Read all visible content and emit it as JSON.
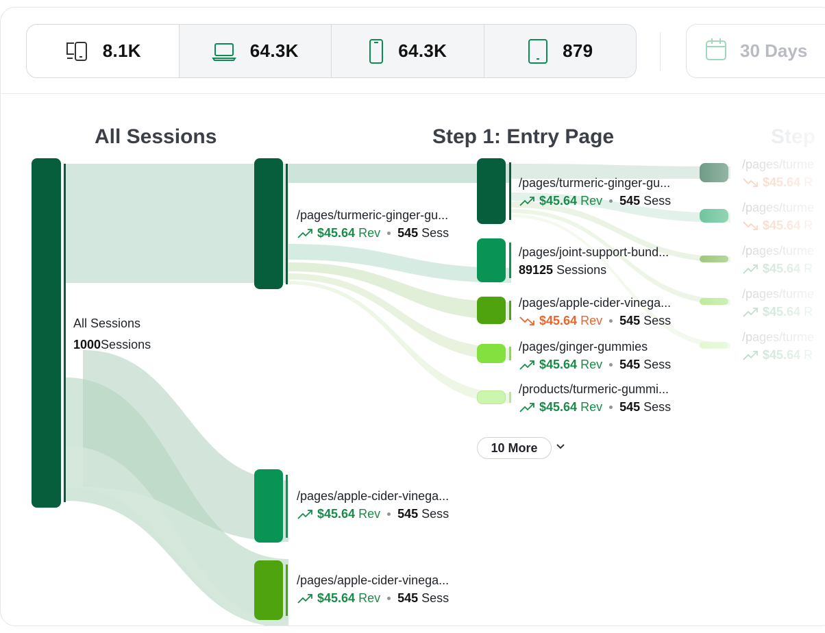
{
  "devices": [
    {
      "icon": "multi-device-icon",
      "value": "8.1K"
    },
    {
      "icon": "laptop-icon",
      "value": "64.3K"
    },
    {
      "icon": "phone-icon",
      "value": "64.3K"
    },
    {
      "icon": "tablet-icon",
      "value": "879"
    }
  ],
  "date_range": {
    "label": "30 Days",
    "icon": "calendar-icon"
  },
  "stages": {
    "all_sessions": "All Sessions",
    "step1": "Step 1: Entry Page",
    "step2": "Step"
  },
  "root": {
    "name": "All Sessions",
    "count": "1000",
    "count_suffix": " Sessions"
  },
  "column1": [
    {
      "path": "/pages/turmeric-ginger-gu...",
      "rev": "$45.64",
      "rev_suffix": " Rev",
      "sess": "545",
      "sess_suffix": " Sess",
      "trend": "up"
    },
    {
      "path": "/pages/apple-cider-vinega...",
      "rev": "$45.64",
      "rev_suffix": " Rev",
      "sess": "545",
      "sess_suffix": " Sess",
      "trend": "up"
    },
    {
      "path": "/pages/apple-cider-vinega...",
      "rev": "$45.64",
      "rev_suffix": " Rev",
      "sess": "545",
      "sess_suffix": " Sess",
      "trend": "up"
    }
  ],
  "column2": [
    {
      "path": "/pages/turmeric-ginger-gu...",
      "rev": "$45.64",
      "rev_suffix": " Rev",
      "sess": "545",
      "sess_suffix": " Sess",
      "trend": "up"
    },
    {
      "path": "/pages/joint-support-bund...",
      "count": "89125",
      "count_suffix": " Sessions"
    },
    {
      "path": "/pages/apple-cider-vinega...",
      "rev": "$45.64",
      "rev_suffix": " Rev",
      "sess": "545",
      "sess_suffix": " Sess",
      "trend": "down"
    },
    {
      "path": "/pages/ginger-gummies",
      "rev": "$45.64",
      "rev_suffix": " Rev",
      "sess": "545",
      "sess_suffix": " Sess",
      "trend": "up"
    },
    {
      "path": "/products/turmeric-gummi...",
      "rev": "$45.64",
      "rev_suffix": " Rev",
      "sess": "545",
      "sess_suffix": " Sess",
      "trend": "up"
    }
  ],
  "more": {
    "label": "10 More"
  },
  "column3": [
    {
      "path": "/pages/turme",
      "rev": "$45.64",
      "rev_suffix": " R",
      "trend": "down"
    },
    {
      "path": "/pages/turme",
      "rev": "$45.64",
      "rev_suffix": " R",
      "trend": "down"
    },
    {
      "path": "/pages/turme",
      "rev": "$45.64",
      "rev_suffix": " R",
      "trend": "up"
    },
    {
      "path": "/pages/turme",
      "rev": "$45.64",
      "rev_suffix": " R",
      "trend": "up"
    },
    {
      "path": "/pages/turme",
      "rev": "$45.64",
      "rev_suffix": " R",
      "trend": "up"
    }
  ],
  "colors": {
    "dark_green": "#075e3c",
    "green": "#099456",
    "olive": "#4fa30f",
    "lime": "#84e03f",
    "pale_lime": "#ccf5ad",
    "flow": "#c9e1d6",
    "up": "#1a8a48",
    "down": "#e8652b"
  }
}
